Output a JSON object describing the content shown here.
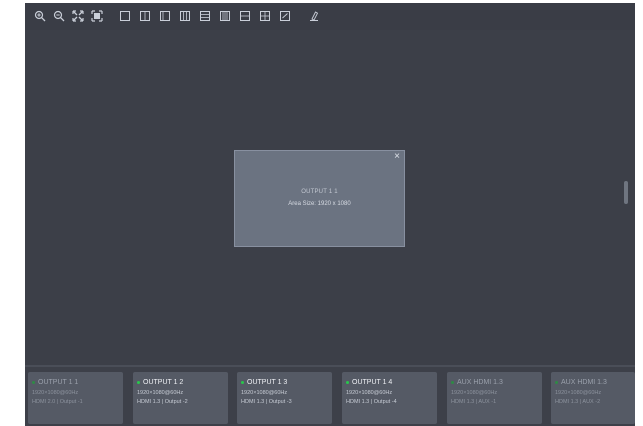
{
  "toolbar": {
    "buttons": [
      {
        "icon": "zoom-in-icon"
      },
      {
        "icon": "zoom-out-icon"
      },
      {
        "icon": "fit-to-screen-icon"
      },
      {
        "icon": "fullscreen-icon"
      },
      {
        "icon": "layout-single-icon"
      },
      {
        "icon": "layout-split-vertical-icon"
      },
      {
        "icon": "layout-split-left-icon"
      },
      {
        "icon": "layout-three-column-icon"
      },
      {
        "icon": "layout-rows-icon"
      },
      {
        "icon": "layout-columns-icon"
      },
      {
        "icon": "layout-split-horizontal-icon"
      },
      {
        "icon": "layout-quad-icon"
      },
      {
        "icon": "layout-custom-icon"
      },
      {
        "icon": "clear-layout-icon"
      }
    ]
  },
  "canvas": {
    "window": {
      "close": "×",
      "title": "OUTPUT 1 1",
      "size": "Area Size: 1920 x 1080"
    }
  },
  "outputs": [
    {
      "title": "OUTPUT 1 1",
      "resolution": "1920×1080@60Hz",
      "port": "HDMI 2.0 | Output -1",
      "active": false
    },
    {
      "title": "OUTPUT 1 2",
      "resolution": "1920×1080@60Hz",
      "port": "HDMI 1.3 | Output -2",
      "active": true
    },
    {
      "title": "OUTPUT 1 3",
      "resolution": "1920×1080@60Hz",
      "port": "HDMI 1.3 | Output -3",
      "active": true
    },
    {
      "title": "OUTPUT 1 4",
      "resolution": "1920×1080@60Hz",
      "port": "HDMI 1.3 | Output -4",
      "active": true
    },
    {
      "title": "AUX HDMI 1.3",
      "resolution": "1920×1080@60Hz",
      "port": "HDMI 1.3 | AUX -1",
      "active": false
    },
    {
      "title": "AUX HDMI 1.3",
      "resolution": "1920×1080@60Hz",
      "port": "HDMI 1.3 | AUX -2",
      "active": false
    }
  ],
  "colors": {
    "background": "#3a3d46",
    "window": "#6b7381",
    "card": "#555a65",
    "status_green": "#28c84b"
  }
}
